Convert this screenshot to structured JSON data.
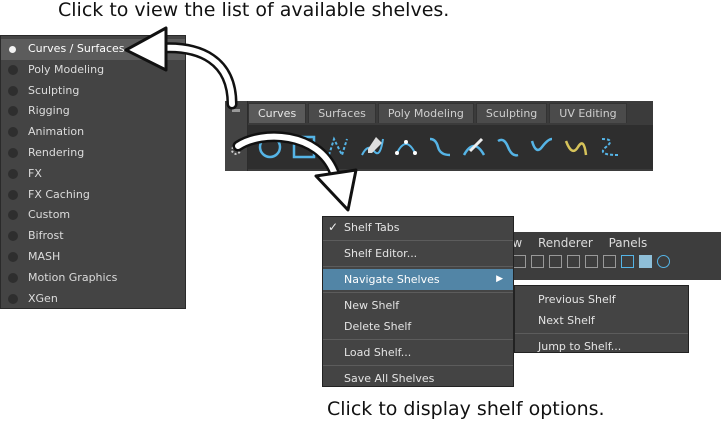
{
  "captions": {
    "top": "Click to view the list of available shelves.",
    "bottom": "Click to display shelf options."
  },
  "shelf_list": {
    "items": [
      {
        "label": "Curves / Surfaces",
        "selected": true
      },
      {
        "label": "Poly Modeling",
        "selected": false
      },
      {
        "label": "Sculpting",
        "selected": false
      },
      {
        "label": "Rigging",
        "selected": false
      },
      {
        "label": "Animation",
        "selected": false
      },
      {
        "label": "Rendering",
        "selected": false
      },
      {
        "label": "FX",
        "selected": false
      },
      {
        "label": "FX Caching",
        "selected": false
      },
      {
        "label": "Custom",
        "selected": false
      },
      {
        "label": "Bifrost",
        "selected": false
      },
      {
        "label": "MASH",
        "selected": false
      },
      {
        "label": "Motion Graphics",
        "selected": false
      },
      {
        "label": "XGen",
        "selected": false
      }
    ]
  },
  "shelf_bar": {
    "tabs": [
      "Curves",
      "Surfaces",
      "Poly Modeling",
      "Sculpting",
      "UV Editing"
    ],
    "tool_icons": [
      "circle-curve-icon",
      "square-curve-icon",
      "cv-curve-icon",
      "pencil-curve-icon",
      "ep-curve-icon",
      "bezier-curve-icon",
      "three-point-arc-icon",
      "curve-edit-icon",
      "attach-curves-icon",
      "rebuild-curve-icon",
      "extend-curve-icon"
    ]
  },
  "menu_bar": {
    "items": [
      "ow",
      "Renderer",
      "Panels"
    ]
  },
  "context_menu": {
    "shelf_tabs": "Shelf Tabs",
    "check": "✓",
    "shelf_editor": "Shelf Editor...",
    "navigate_shelves": "Navigate Shelves",
    "new_shelf": "New Shelf",
    "delete_shelf": "Delete Shelf",
    "load_shelf": "Load Shelf...",
    "save_all_shelves": "Save All Shelves"
  },
  "submenu": {
    "previous_shelf": "Previous Shelf",
    "next_shelf": "Next Shelf",
    "jump_to_shelf": "Jump to Shelf..."
  },
  "colors": {
    "panel": "#444444",
    "highlight": "#5285a6",
    "icon_blue": "#55b4e6",
    "icon_yellow": "#d6c35a"
  }
}
